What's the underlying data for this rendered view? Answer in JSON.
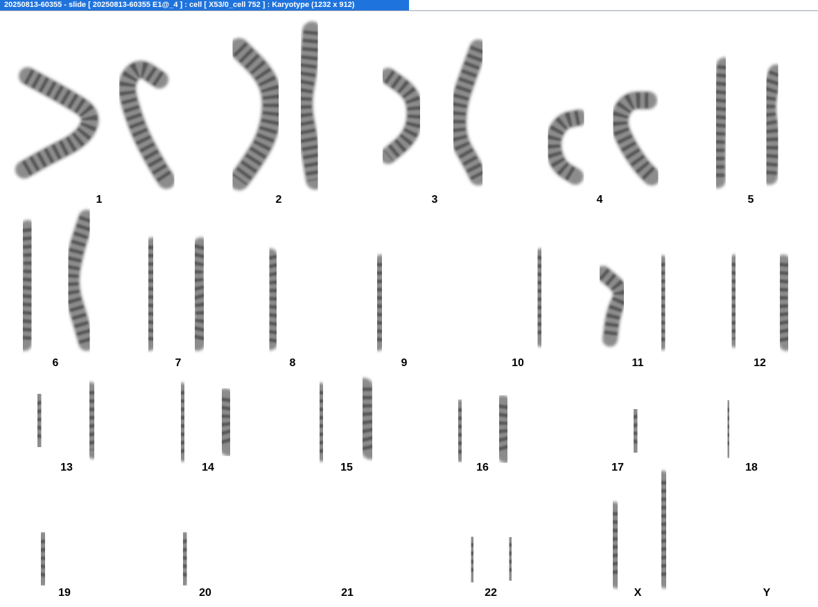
{
  "window": {
    "title": "20250813-60355 - slide [ 20250813-60355 E1@_4 ] : cell [ X53/0_cell 752 ] : Karyotype  (1232 x 912)"
  },
  "karyotype": {
    "labels": [
      "1",
      "2",
      "3",
      "4",
      "5",
      "6",
      "7",
      "8",
      "9",
      "10",
      "11",
      "12",
      "13",
      "14",
      "15",
      "16",
      "17",
      "18",
      "19",
      "20",
      "21",
      "22",
      "X",
      "Y"
    ]
  },
  "colors": {
    "title_bar": "#1f73dc",
    "title_text": "#ffffff",
    "chromosome": "#8c8c8c",
    "band": "#3c3c3c",
    "label": "#000000"
  }
}
